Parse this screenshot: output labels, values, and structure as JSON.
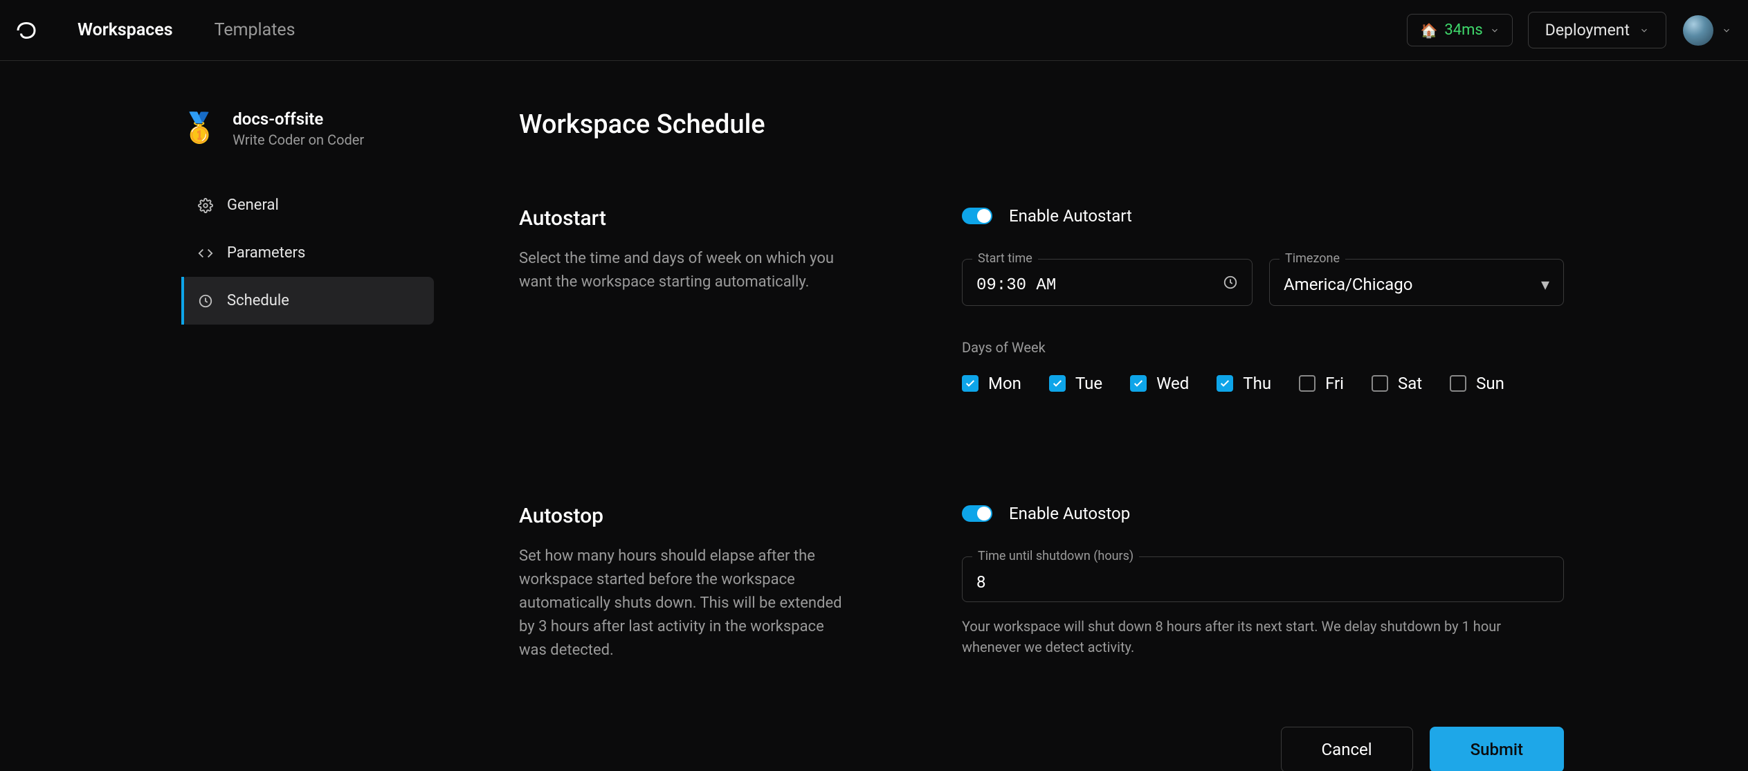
{
  "nav": {
    "workspaces": "Workspaces",
    "templates": "Templates",
    "latency_ms": "34ms",
    "deployment": "Deployment"
  },
  "workspace": {
    "name": "docs-offsite",
    "subtitle": "Write Coder on Coder"
  },
  "sidebar": {
    "general": "General",
    "parameters": "Parameters",
    "schedule": "Schedule"
  },
  "page": {
    "title": "Workspace Schedule"
  },
  "autostart": {
    "title": "Autostart",
    "desc": "Select the time and days of week on which you want the workspace starting automatically.",
    "enable_label": "Enable Autostart",
    "start_time_label": "Start time",
    "start_time_value": "09:30 AM",
    "timezone_label": "Timezone",
    "timezone_value": "America/Chicago",
    "dow_label": "Days of Week",
    "days": {
      "mon": "Mon",
      "tue": "Tue",
      "wed": "Wed",
      "thu": "Thu",
      "fri": "Fri",
      "sat": "Sat",
      "sun": "Sun"
    },
    "checked": {
      "mon": true,
      "tue": true,
      "wed": true,
      "thu": true,
      "fri": false,
      "sat": false,
      "sun": false
    }
  },
  "autostop": {
    "title": "Autostop",
    "desc": "Set how many hours should elapse after the workspace started before the workspace automatically shuts down. This will be extended by 3 hours after last activity in the workspace was detected.",
    "enable_label": "Enable Autostop",
    "hours_label": "Time until shutdown (hours)",
    "hours_value": "8",
    "helper": "Your workspace will shut down 8 hours after its next start. We delay shutdown by 1 hour whenever we detect activity."
  },
  "footer": {
    "cancel": "Cancel",
    "submit": "Submit"
  }
}
